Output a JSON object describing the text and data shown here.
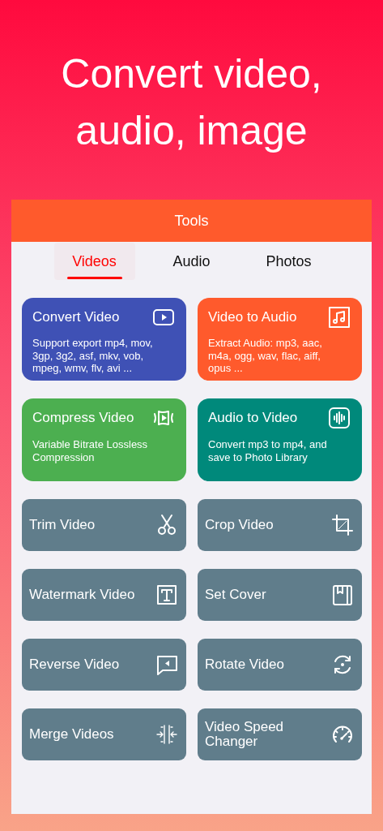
{
  "headline": "Convert video, audio, image",
  "panel": {
    "title": "Tools",
    "tabs": [
      {
        "label": "Videos",
        "selected": true
      },
      {
        "label": "Audio",
        "selected": false
      },
      {
        "label": "Photos",
        "selected": false
      }
    ],
    "features": [
      {
        "title": "Convert Video",
        "description": "Support export mp4, mov, 3gp, 3g2, asf, mkv, vob, mpeg, wmv, flv, avi ...",
        "color": "#3f51b5"
      },
      {
        "title": "Video to Audio",
        "description": "Extract Audio: mp3, aac, m4a, ogg, wav, flac, aiff, opus ...",
        "color": "#ff5a2c"
      },
      {
        "title": "Compress Video",
        "description": "Variable Bitrate Lossless Compression",
        "color": "#4caf50"
      },
      {
        "title": "Audio to Video",
        "description": "Convert mp3 to mp4, and save to Photo Library",
        "color": "#00897b"
      }
    ],
    "tools": [
      {
        "label": "Trim Video"
      },
      {
        "label": "Crop Video"
      },
      {
        "label": "Watermark Video"
      },
      {
        "label": "Set Cover"
      },
      {
        "label": "Reverse Video"
      },
      {
        "label": "Rotate Video"
      },
      {
        "label": "Merge Videos"
      },
      {
        "label": "Video Speed Changer"
      }
    ]
  }
}
